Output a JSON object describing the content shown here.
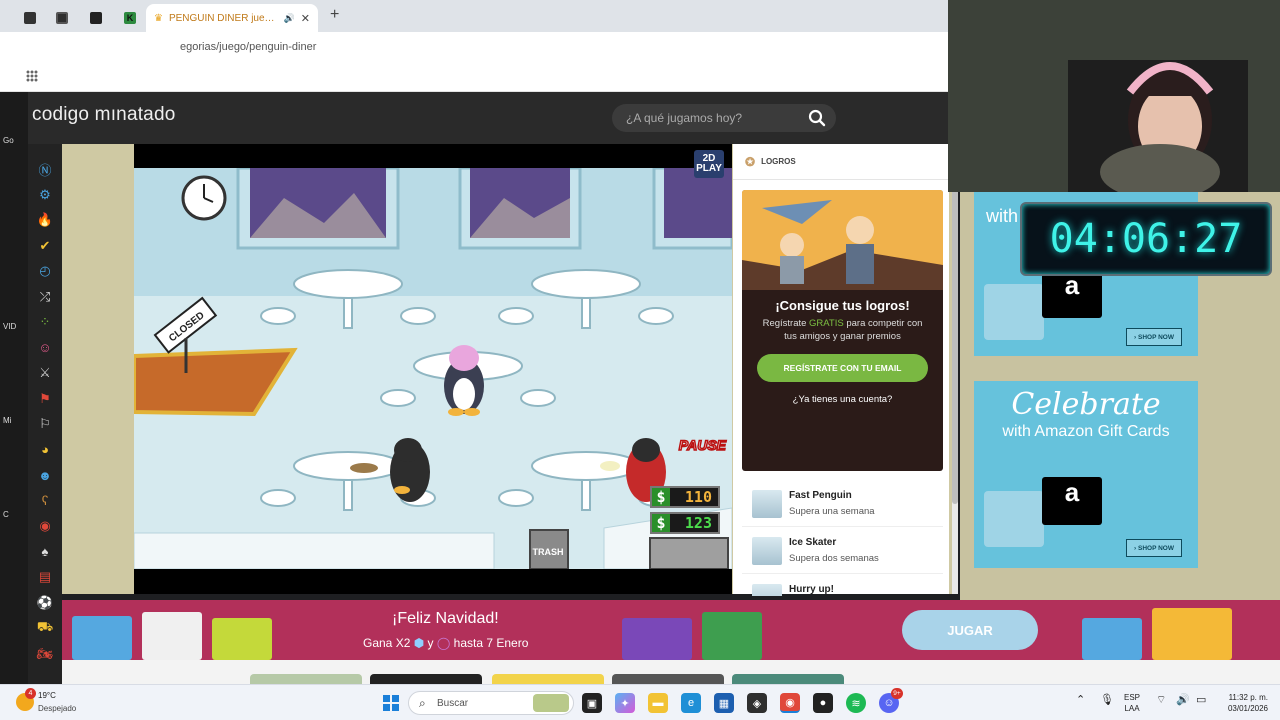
{
  "browser": {
    "tabs": [
      {
        "favicon": "tab-icon-1",
        "color": "#333333"
      },
      {
        "favicon": "tab-icon-2",
        "color": "#2f2f2f"
      },
      {
        "favicon": "k-icon",
        "color": "#2d8a3f"
      }
    ],
    "active_tab": {
      "title": "PENGUIN DINER juego gra",
      "favicon": "crown-icon"
    },
    "new_tab": "+",
    "url": "egorias/juego/penguin-diner"
  },
  "site": {
    "logo_text": "codigo mınatado",
    "search_placeholder": "¿A qué jugamos hoy?"
  },
  "left_strip": [
    "Go",
    "VID",
    "Mi",
    "C"
  ],
  "sidebar_icons": [
    {
      "name": "new-icon",
      "glyph": "Ⓝ",
      "color": "#4aa3df"
    },
    {
      "name": "gear-icon",
      "glyph": "⚙",
      "color": "#4aa3df"
    },
    {
      "name": "fire-icon",
      "glyph": "🔥",
      "color": "#e0483a"
    },
    {
      "name": "check-icon",
      "glyph": "✔",
      "color": "#f2c335"
    },
    {
      "name": "clock-icon",
      "glyph": "◴",
      "color": "#4aa3df"
    },
    {
      "name": "shuffle-icon",
      "glyph": "⤮",
      "color": "#dddddd"
    },
    {
      "name": "dots-icon",
      "glyph": "⁘",
      "color": "#7cc042"
    },
    {
      "name": "people-icon",
      "glyph": "☺",
      "color": "#e05a8a"
    },
    {
      "name": "swords-icon",
      "glyph": "⚔",
      "color": "#cccccc"
    },
    {
      "name": "flag-icon",
      "glyph": "⚑",
      "color": "#e0483a"
    },
    {
      "name": "checkered-flag-icon",
      "glyph": "⚐",
      "color": "#dddddd"
    },
    {
      "name": "pacman-icon",
      "glyph": "◕",
      "color": "#f2c335"
    },
    {
      "name": "family-icon",
      "glyph": "☻",
      "color": "#4aa3df"
    },
    {
      "name": "bear-icon",
      "glyph": "ʕ",
      "color": "#c98b3c"
    },
    {
      "name": "pokeball-icon",
      "glyph": "◉",
      "color": "#e0483a"
    },
    {
      "name": "spade-icon",
      "glyph": "♠",
      "color": "#dddddd"
    },
    {
      "name": "cards-icon",
      "glyph": "▤",
      "color": "#e0483a"
    },
    {
      "name": "soccer-icon",
      "glyph": "⚽",
      "color": "#dddddd"
    },
    {
      "name": "car-icon",
      "glyph": "⛟",
      "color": "#f2c335"
    },
    {
      "name": "bike-icon",
      "glyph": "🏍",
      "color": "#e0483a"
    }
  ],
  "game": {
    "sign": "CLOSED",
    "pause": "PAUSE",
    "money": [
      {
        "symbol": "$",
        "amount": "110"
      },
      {
        "symbol": "$",
        "amount": "123"
      }
    ],
    "trash": "TRASH",
    "publisher": "2D PLAY"
  },
  "achievements": {
    "header": "LOGROS",
    "promo_title": "¡Consigue tus logros!",
    "promo_text_before": "Regístrate ",
    "promo_text_highlight": "GRATIS",
    "promo_text_after": " para competir con tus amigos y ganar premios",
    "register_button": "REGÍSTRATE CON TU EMAIL",
    "login_link": "¿Ya tienes una cuenta?",
    "items": [
      {
        "name": "Fast Penguin",
        "desc": "Supera una semana"
      },
      {
        "name": "Ice Skater",
        "desc": "Supera dos semanas"
      },
      {
        "name": "Hurry up!",
        "desc": ""
      }
    ]
  },
  "ads": {
    "top": {
      "headline": "with",
      "shop": "› SHOP NOW",
      "brand": "a"
    },
    "bottom": {
      "headline": "Celebrate",
      "subline": "with Amazon Gift Cards",
      "shop": "› SHOP NOW",
      "brand": "a"
    }
  },
  "timer": "04:06:27",
  "banner": {
    "title": "¡Feliz Navidad!",
    "subtitle_before": "Gana X2",
    "subtitle_mid": "y",
    "subtitle_after": "hasta 7 Enero",
    "button": "JUGAR"
  },
  "taskbar": {
    "weather_temp": "19°C",
    "weather_desc": "Despejado",
    "search_placeholder": "Buscar",
    "notification_badge": "4",
    "lang_top": "ESP",
    "lang_bottom": "LAA",
    "time": "11:32 p. m.",
    "date": "03/01/2026",
    "discord_badge": "9+"
  }
}
